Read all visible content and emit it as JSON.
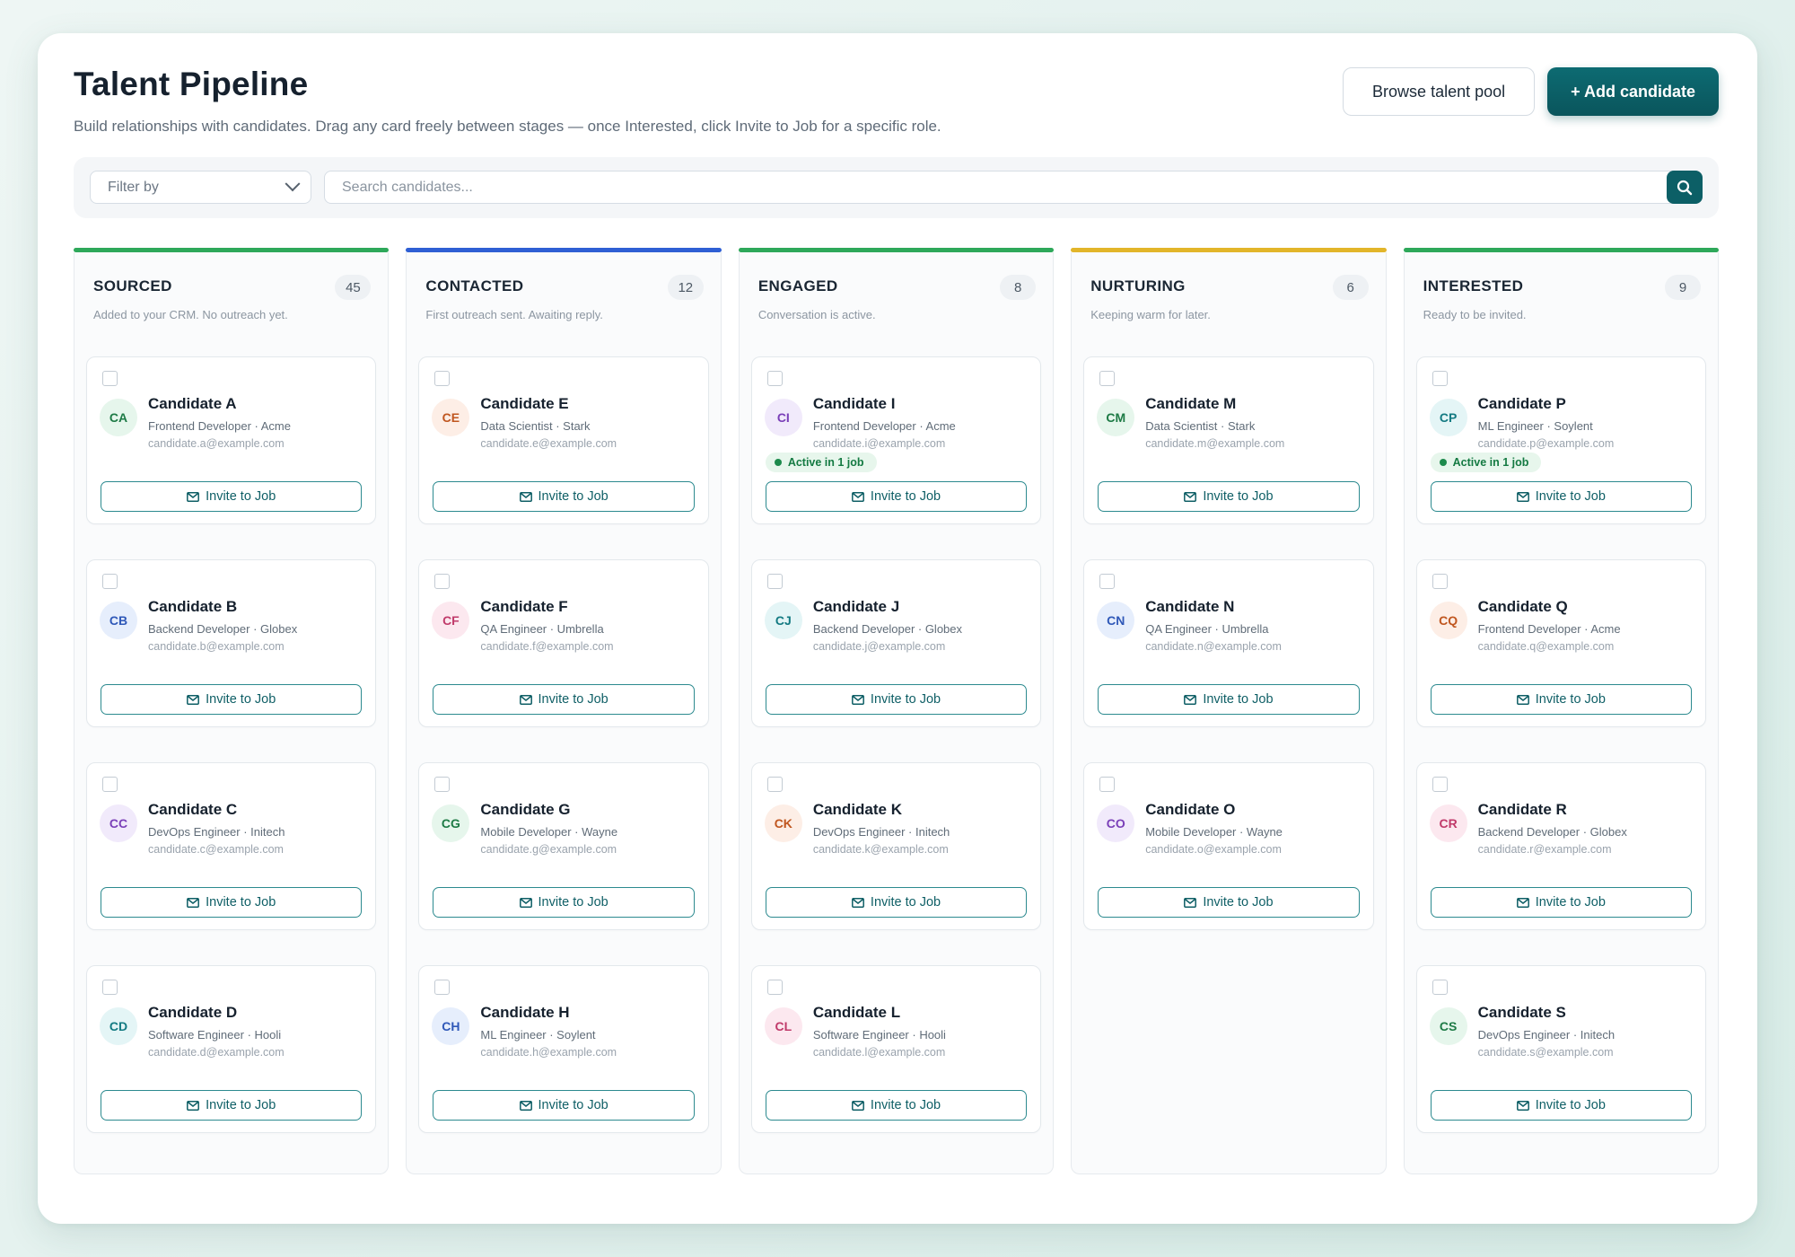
{
  "header": {
    "title": "Talent Pipeline",
    "subtitle": "Build relationships with candidates. Drag any card freely between stages — once Interested, click Invite to Job for a specific role.",
    "browse_label": "Browse talent pool",
    "add_label": "+ Add candidate"
  },
  "filters": {
    "filter_label": "Filter by",
    "search_placeholder": "Search candidates..."
  },
  "colors": {
    "sourced": "#2ea85a",
    "contacted": "#2f5fd4",
    "engaged": "#2ea85a",
    "nurturing": "#e2b52a",
    "interested": "#2ea85a",
    "brand": "#0c5f66"
  },
  "columns": [
    {
      "key": "sourced",
      "title": "SOURCED",
      "count": "45",
      "desc": "Added to your CRM. No outreach yet.",
      "cards": [
        {
          "initials": "CA",
          "name": "Candidate A",
          "role": "Frontend Developer · Acme",
          "email": "candidate.a@example.com",
          "badge": "",
          "bg": "#e6f6ec",
          "fg": "#1d7a45",
          "invite": "Invite to Job"
        },
        {
          "initials": "CB",
          "name": "Candidate B",
          "role": "Backend Developer · Globex",
          "email": "candidate.b@example.com",
          "badge": "",
          "bg": "#e6eefc",
          "fg": "#2f58b8",
          "invite": "Invite to Job"
        },
        {
          "initials": "CC",
          "name": "Candidate C",
          "role": "DevOps Engineer · Initech",
          "email": "candidate.c@example.com",
          "badge": "",
          "bg": "#f1eafb",
          "fg": "#7a3fb8",
          "invite": "Invite to Job"
        },
        {
          "initials": "CD",
          "name": "Candidate D",
          "role": "Software Engineer · Hooli",
          "email": "candidate.d@example.com",
          "badge": "",
          "bg": "#e4f5f6",
          "fg": "#137a82",
          "invite": "Invite to Job"
        }
      ]
    },
    {
      "key": "contacted",
      "title": "CONTACTED",
      "count": "12",
      "desc": "First outreach sent. Awaiting reply.",
      "cards": [
        {
          "initials": "CE",
          "name": "Candidate E",
          "role": "Data Scientist · Stark",
          "email": "candidate.e@example.com",
          "badge": "",
          "bg": "#fdeee6",
          "fg": "#c0561f",
          "invite": "Invite to Job"
        },
        {
          "initials": "CF",
          "name": "Candidate F",
          "role": "QA Engineer · Umbrella",
          "email": "candidate.f@example.com",
          "badge": "",
          "bg": "#fce8ef",
          "fg": "#c03a6a",
          "invite": "Invite to Job"
        },
        {
          "initials": "CG",
          "name": "Candidate G",
          "role": "Mobile Developer · Wayne",
          "email": "candidate.g@example.com",
          "badge": "",
          "bg": "#e6f6ec",
          "fg": "#1d7a45",
          "invite": "Invite to Job"
        },
        {
          "initials": "CH",
          "name": "Candidate H",
          "role": "ML Engineer · Soylent",
          "email": "candidate.h@example.com",
          "badge": "",
          "bg": "#e6eefc",
          "fg": "#2f58b8",
          "invite": "Invite to Job"
        }
      ]
    },
    {
      "key": "engaged",
      "title": "ENGAGED",
      "count": "8",
      "desc": "Conversation is active.",
      "cards": [
        {
          "initials": "CI",
          "name": "Candidate I",
          "role": "Frontend Developer · Acme",
          "email": "candidate.i@example.com",
          "badge": "Active in 1 job",
          "bg": "#f1eafb",
          "fg": "#7a3fb8",
          "invite": "Invite to Job"
        },
        {
          "initials": "CJ",
          "name": "Candidate J",
          "role": "Backend Developer · Globex",
          "email": "candidate.j@example.com",
          "badge": "",
          "bg": "#e4f5f6",
          "fg": "#137a82",
          "invite": "Invite to Job"
        },
        {
          "initials": "CK",
          "name": "Candidate K",
          "role": "DevOps Engineer · Initech",
          "email": "candidate.k@example.com",
          "badge": "",
          "bg": "#fdeee6",
          "fg": "#c0561f",
          "invite": "Invite to Job"
        },
        {
          "initials": "CL",
          "name": "Candidate L",
          "role": "Software Engineer · Hooli",
          "email": "candidate.l@example.com",
          "badge": "",
          "bg": "#fce8ef",
          "fg": "#c03a6a",
          "invite": "Invite to Job"
        }
      ]
    },
    {
      "key": "nurturing",
      "title": "NURTURING",
      "count": "6",
      "desc": "Keeping warm for later.",
      "cards": [
        {
          "initials": "CM",
          "name": "Candidate M",
          "role": "Data Scientist · Stark",
          "email": "candidate.m@example.com",
          "badge": "",
          "bg": "#e6f6ec",
          "fg": "#1d7a45",
          "invite": "Invite to Job"
        },
        {
          "initials": "CN",
          "name": "Candidate N",
          "role": "QA Engineer · Umbrella",
          "email": "candidate.n@example.com",
          "badge": "",
          "bg": "#e6eefc",
          "fg": "#2f58b8",
          "invite": "Invite to Job"
        },
        {
          "initials": "CO",
          "name": "Candidate O",
          "role": "Mobile Developer · Wayne",
          "email": "candidate.o@example.com",
          "badge": "",
          "bg": "#f1eafb",
          "fg": "#7a3fb8",
          "invite": "Invite to Job"
        }
      ]
    },
    {
      "key": "interested",
      "title": "INTERESTED",
      "count": "9",
      "desc": "Ready to be invited.",
      "cards": [
        {
          "initials": "CP",
          "name": "Candidate P",
          "role": "ML Engineer · Soylent",
          "email": "candidate.p@example.com",
          "badge": "Active in 1 job",
          "bg": "#e4f5f6",
          "fg": "#137a82",
          "invite": "Invite to Job"
        },
        {
          "initials": "CQ",
          "name": "Candidate Q",
          "role": "Frontend Developer · Acme",
          "email": "candidate.q@example.com",
          "badge": "",
          "bg": "#fdeee6",
          "fg": "#c0561f",
          "invite": "Invite to Job"
        },
        {
          "initials": "CR",
          "name": "Candidate R",
          "role": "Backend Developer · Globex",
          "email": "candidate.r@example.com",
          "badge": "",
          "bg": "#fce8ef",
          "fg": "#c03a6a",
          "invite": "Invite to Job"
        },
        {
          "initials": "CS",
          "name": "Candidate S",
          "role": "DevOps Engineer · Initech",
          "email": "candidate.s@example.com",
          "badge": "",
          "bg": "#e6f6ec",
          "fg": "#1d7a45",
          "invite": "Invite to Job"
        }
      ]
    }
  ]
}
